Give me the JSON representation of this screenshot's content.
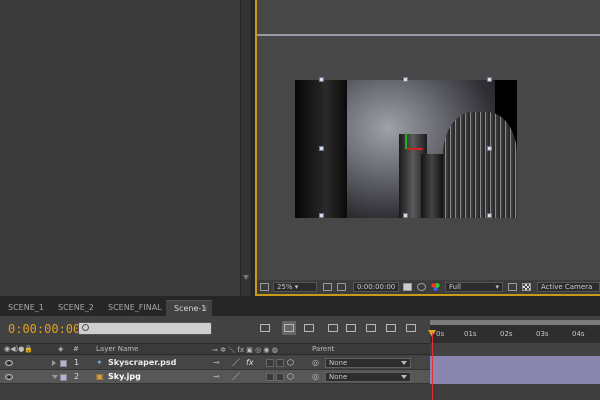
{
  "comp_viewer": {
    "zoom": "25%",
    "timecode": "0:00:00:00",
    "resolution": "Full",
    "camera": "Active Camera"
  },
  "tabs": [
    {
      "label": "SCENE_1",
      "active": false
    },
    {
      "label": "SCENE_2",
      "active": false
    },
    {
      "label": "SCENE_FINAL",
      "active": false
    },
    {
      "label": "Scene-1",
      "active": true
    }
  ],
  "tab_close": "×",
  "timeline": {
    "current_time": "0:00:00:00",
    "search_placeholder": "",
    "columns": {
      "hash": "#",
      "layer_name": "Layer Name",
      "parent": "Parent"
    },
    "ruler": [
      "0s",
      "01s",
      "02s",
      "03s",
      "04s"
    ],
    "layers": [
      {
        "index": "1",
        "name": "Skyscraper.psd",
        "parent": "None",
        "expanded": false,
        "selected": false,
        "label_color": "#b8b0d8",
        "switch_fx": "fx"
      },
      {
        "index": "2",
        "name": "Sky.jpg",
        "parent": "None",
        "expanded": true,
        "selected": true,
        "label_color": "#b8b0d8"
      }
    ]
  },
  "colors": {
    "accent": "#c99a18",
    "timecode": "#e0a020",
    "cti": "#e03030",
    "track_bar": "#8a86b0"
  }
}
